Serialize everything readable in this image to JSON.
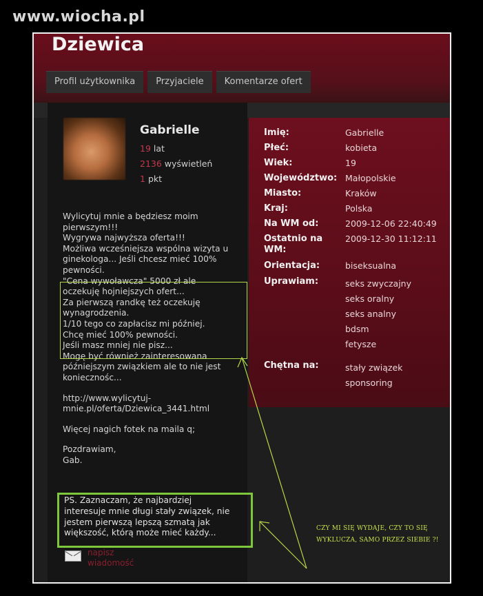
{
  "watermark": "www.wiocha.pl",
  "page": {
    "title": "Dziewica"
  },
  "tabs": [
    "Profil użytkownika",
    "Przyjaciele",
    "Komentarze ofert"
  ],
  "profile": {
    "name": "Gabrielle",
    "age_num": "19",
    "age_unit": "lat",
    "views_num": "2136",
    "views_unit": "wyświetleń",
    "points_num": "1",
    "points_unit": "pkt",
    "description": [
      "Wylicytuj mnie a będziesz moim\npierwszym!!!\nWygrywa najwyższa oferta!!!\nMożliwa wcześniejsza wspólna wizyta u\nginekologa... Jeśli chcesz mieć 100%\npewności.",
      "\"Cena wywoławcza\" 5000 zł ale\noczekuję hojniejszych ofert...\nZa pierwszą randkę też oczekuję\nwynagrodzenia.\n1/10 tego co zapłacisz mi później.\nChcę mieć 100% pewności.\nJeśli masz mniej nie pisz...",
      "Mogę być również zainteresowana\npóźniejszym związkiem ale to nie jest\nkoniecznośc...",
      "http://www.wylicytuj-\nmnie.pl/oferta/Dziewica_3441.html",
      "Więcej nagich fotek na maila q;",
      "Pozdrawiam,\nGab."
    ],
    "ps": "PS. Zaznaczam, że najbardziej\ninteresuje mnie długi stały związek, nie\njestem pierwszą lepszą szmatą jak\nwiększość, którą może mieć każdy...",
    "message_link": "napisz\nwiadomość"
  },
  "info": {
    "rows": [
      {
        "label": "Imię:",
        "values": [
          "Gabrielle"
        ]
      },
      {
        "label": "Płeć:",
        "values": [
          "kobieta"
        ]
      },
      {
        "label": "Wiek:",
        "values": [
          "19"
        ]
      },
      {
        "label": "Województwo:",
        "values": [
          "Małopolskie"
        ]
      },
      {
        "label": "Miasto:",
        "values": [
          "Kraków"
        ]
      },
      {
        "label": "Kraj:",
        "values": [
          "Polska"
        ]
      },
      {
        "label": "Na WM od:",
        "values": [
          "2009-12-06 22:40:49"
        ]
      },
      {
        "label": "Ostatnio na WM:",
        "values": [
          "2009-12-30 11:12:11"
        ]
      },
      {
        "label": "Orientacja:",
        "values": [
          "biseksualna"
        ]
      },
      {
        "label": "Uprawiam:",
        "values": [
          "seks zwyczajny",
          "seks oralny",
          "seks analny",
          "bdsm",
          "fetysze"
        ]
      },
      {
        "label": "Chętna na:",
        "values": [
          "stały związek",
          "sponsoring"
        ]
      }
    ]
  },
  "annotation": "CZY MI SIĘ WYDAJE, CZY TO SIĘ WYKLUCZA, SAMO PRZEZ SIEBIE ?!",
  "colors": {
    "accent_red": "#6d0f1e",
    "highlight_green": "#7ec63a",
    "note_yellow": "#c8e24a"
  }
}
